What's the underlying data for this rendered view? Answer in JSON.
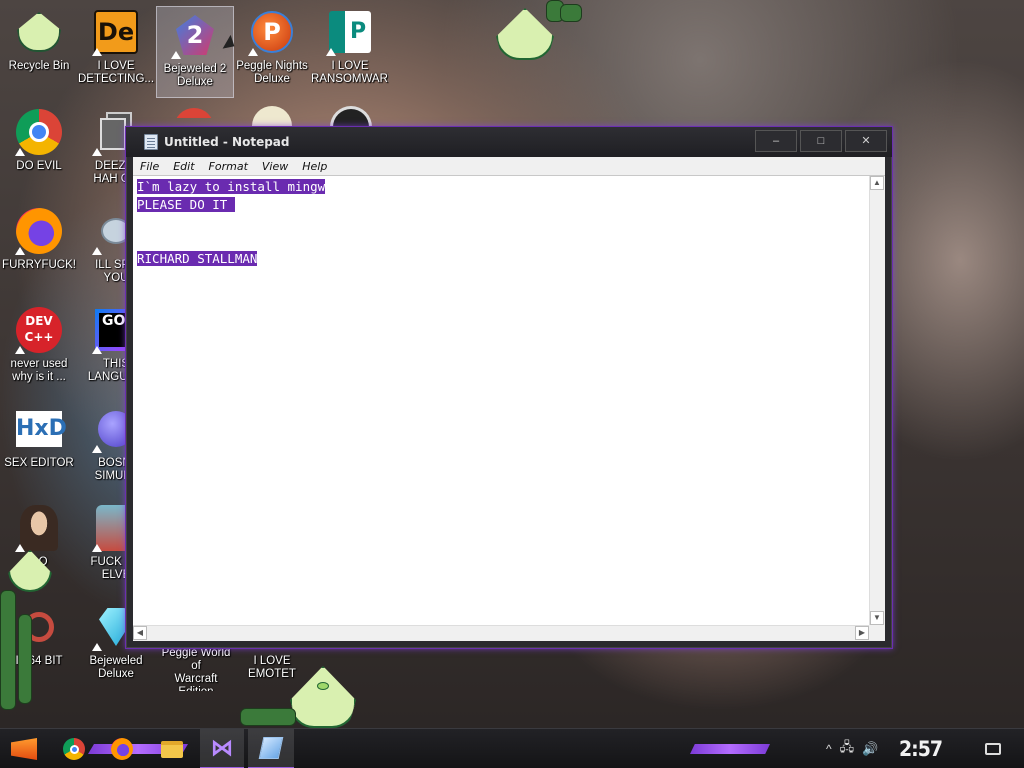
{
  "desktop": {
    "icons": [
      {
        "label": "Recycle Bin",
        "icon": "recycle-bin-peridot-icon"
      },
      {
        "label": "I LOVE\nDETECTING...",
        "icon": "de-app-icon"
      },
      {
        "label": "Bejeweled 2\nDeluxe",
        "icon": "bejeweled-2-icon"
      },
      {
        "label": "Peggle Nights\nDeluxe",
        "icon": "peggle-icon"
      },
      {
        "label": "I LOVE\nRANSOMWARE",
        "icon": "publisher-icon"
      },
      {
        "label": "DO EVIL",
        "icon": "chrome-icon"
      },
      {
        "label": "DEEZ N\nHAH GO",
        "icon": "copy-icon"
      },
      {
        "label": "FURRYFUCK!",
        "icon": "firefox-icon"
      },
      {
        "label": "ILL SPY\nYOU",
        "icon": "spy-icon"
      },
      {
        "label": "never used\nwhy is it ...",
        "icon": "devcpp-icon"
      },
      {
        "label": "THIS\nLANGUAG",
        "icon": "go-icon"
      },
      {
        "label": "SEX EDITOR",
        "icon": "hxd-icon"
      },
      {
        "label": "BOSNI\nSIMULA",
        "icon": "virus-icon"
      },
      {
        "label": "DO",
        "icon": "portrait-icon"
      },
      {
        "label": "FUCK SO\nELVE",
        "icon": "elf-icon"
      },
      {
        "label": "IT 64 BIT",
        "icon": "ie-icon"
      },
      {
        "label": "Bejeweled\nDeluxe",
        "icon": "diamond-icon"
      },
      {
        "label": "Peggle World of\nWarcraft Edition",
        "icon": "peggle-wow-icon"
      },
      {
        "label": "I LOVE EMOTET",
        "icon": "emotet-icon"
      }
    ]
  },
  "notepad": {
    "title": "Untitled - Notepad",
    "controls": {
      "minimize": "–",
      "maximize": "□",
      "close": "✕"
    },
    "menu": [
      "File",
      "Edit",
      "Format",
      "View",
      "Help"
    ],
    "lines": [
      "I`m lazy to install mingw",
      "PLEASE DO IT ",
      "",
      "",
      "RICHARD STALLMAN"
    ]
  },
  "taskbar": {
    "apps": [
      "start-menu-icon",
      "chrome-icon",
      "firefox-icon",
      "file-explorer-icon",
      "visual-studio-icon",
      "notepad-icon"
    ],
    "clock": "2:57 PM",
    "tray_chevron": "^"
  },
  "colors": {
    "accent": "#7c3bd6",
    "selection": "#6a2bb0",
    "peridot": "#d9f0b0"
  }
}
